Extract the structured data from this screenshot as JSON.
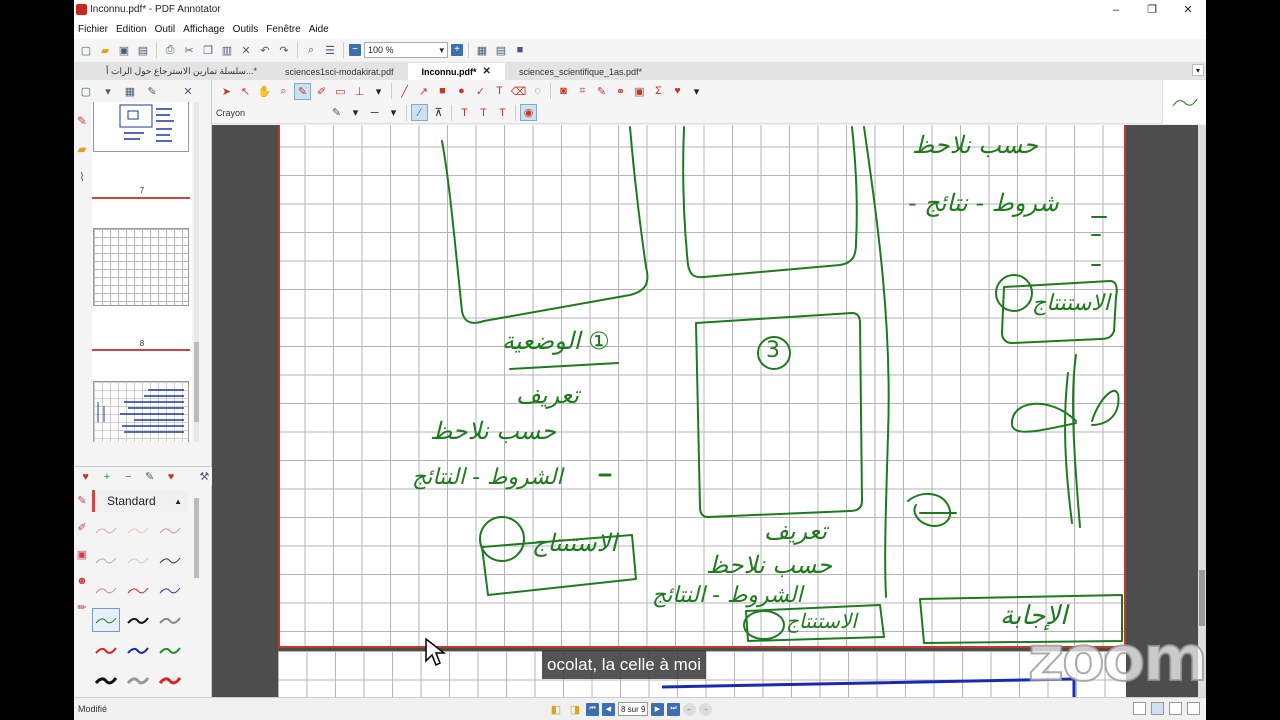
{
  "window": {
    "title": "Inconnu.pdf* - PDF Annotator",
    "minimize": "–",
    "maximize": "❐",
    "close": "✕"
  },
  "menu": [
    "Fichier",
    "Edition",
    "Outil",
    "Affichage",
    "Outils",
    "Fenêtre",
    "Aide"
  ],
  "toolbar": {
    "zoom_value": "100 %",
    "zoom_minus": "−",
    "zoom_plus": "+"
  },
  "tabs": [
    {
      "label": "سلسلة تمارين الاسترجاع حول الرات أ...*",
      "active": false
    },
    {
      "label": "sciences1sci-modakirat.pdf",
      "active": false
    },
    {
      "label": "Inconnu.pdf*",
      "active": true
    },
    {
      "label": "sciences_scientifique_1as.pdf*",
      "active": false
    }
  ],
  "tab_close": "✕",
  "tab_menu": "▾",
  "thumbnails": {
    "labels": [
      "7",
      "8"
    ]
  },
  "pen_panel": {
    "header": "Standard",
    "collapse": "▲"
  },
  "annot_toolbar": {
    "tool_name": "Crayon"
  },
  "subtitle": "ocolat, la celle à moi",
  "watermark": "zoom",
  "status": {
    "left": "Modifié",
    "page_indicator": "8 sur 9"
  },
  "colors": {
    "ink_green": "#1f7a1f",
    "page_border": "#c0392b",
    "accent_blue": "#3b6fb0"
  },
  "handwriting": {
    "top_right_1": "حسب نلاحظ",
    "top_right_2": "- شروط - نتائج",
    "bubble_right": "الاستنتاج",
    "left_title": "الوضعية ①",
    "left_line1": "تعريف",
    "left_line2": "حسب نلاحظ",
    "left_line3": "الشروط - النتائج",
    "left_box": "الاستنتاج",
    "circle_3": "3",
    "mid_line1": "تعريف",
    "mid_line2": "حسب نلاحظ",
    "mid_line3": "الشروط - النتائج",
    "mid_box": "الاستنتاج",
    "bottom_right_box": "الإجابة"
  }
}
